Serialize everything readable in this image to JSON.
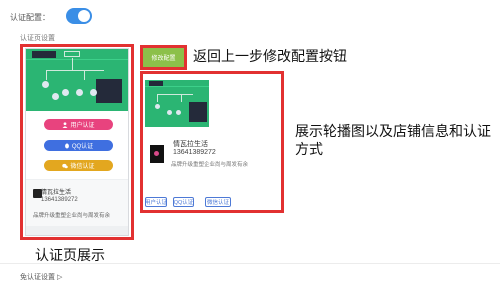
{
  "header": {
    "auth_label": "认证配置：",
    "page_settings_label": "认证页设置"
  },
  "toggle": {
    "state": "on",
    "color": "#3a8ee6"
  },
  "phone_preview": {
    "buttons": {
      "user_auth": "用户认证",
      "qq_auth": "QQ认证",
      "wechat_auth": "微信认证"
    },
    "shop": {
      "name": "情瓦拉生活",
      "phone": "13641389272",
      "desc": "品牌升级重塑企业尚与周发有余"
    }
  },
  "edit_button": {
    "label": "修改配置"
  },
  "right_preview": {
    "shop": {
      "name": "情瓦拉生活",
      "phone": "13641389272",
      "desc": "品牌升级重塑企业尚与周发有余"
    },
    "auth_tags": [
      "用户认证",
      "QQ认证",
      "微信认证"
    ]
  },
  "annotations": {
    "back_edit": "返回上一步修改配置按钮",
    "show_line1": "展示轮播图以及店铺信息和认证",
    "show_line2": "方式",
    "page_show": "认证页展示"
  },
  "footer": {
    "label": "免认证设置 ▷"
  },
  "colors": {
    "annotation_frame": "#e23131",
    "banner": "#2bb573",
    "user_auth": "#e8437e",
    "qq_auth": "#3f6fe0",
    "wechat_auth": "#e3a71f",
    "edit_button": "#8cc04a",
    "outline": "#4d79d6"
  },
  "icons": {
    "user_auth": "user-icon",
    "qq_auth": "qq-icon",
    "wechat_auth": "wechat-icon"
  }
}
